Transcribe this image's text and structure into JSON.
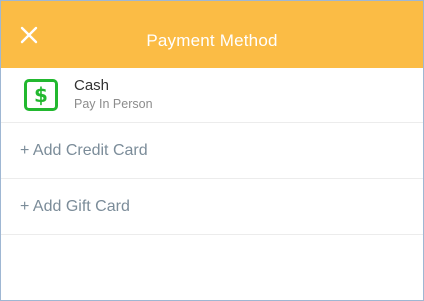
{
  "header": {
    "title": "Payment Method",
    "close_icon": "close-icon",
    "background_color": "#fbbc45"
  },
  "payment_methods": [
    {
      "icon": "dollar-bill-icon",
      "icon_glyph": "$",
      "icon_color": "#22b82f",
      "name": "Cash",
      "subtitle": "Pay In Person"
    }
  ],
  "actions": {
    "add_credit_card": "+ Add Credit Card",
    "add_gift_card": "+ Add Gift Card"
  }
}
